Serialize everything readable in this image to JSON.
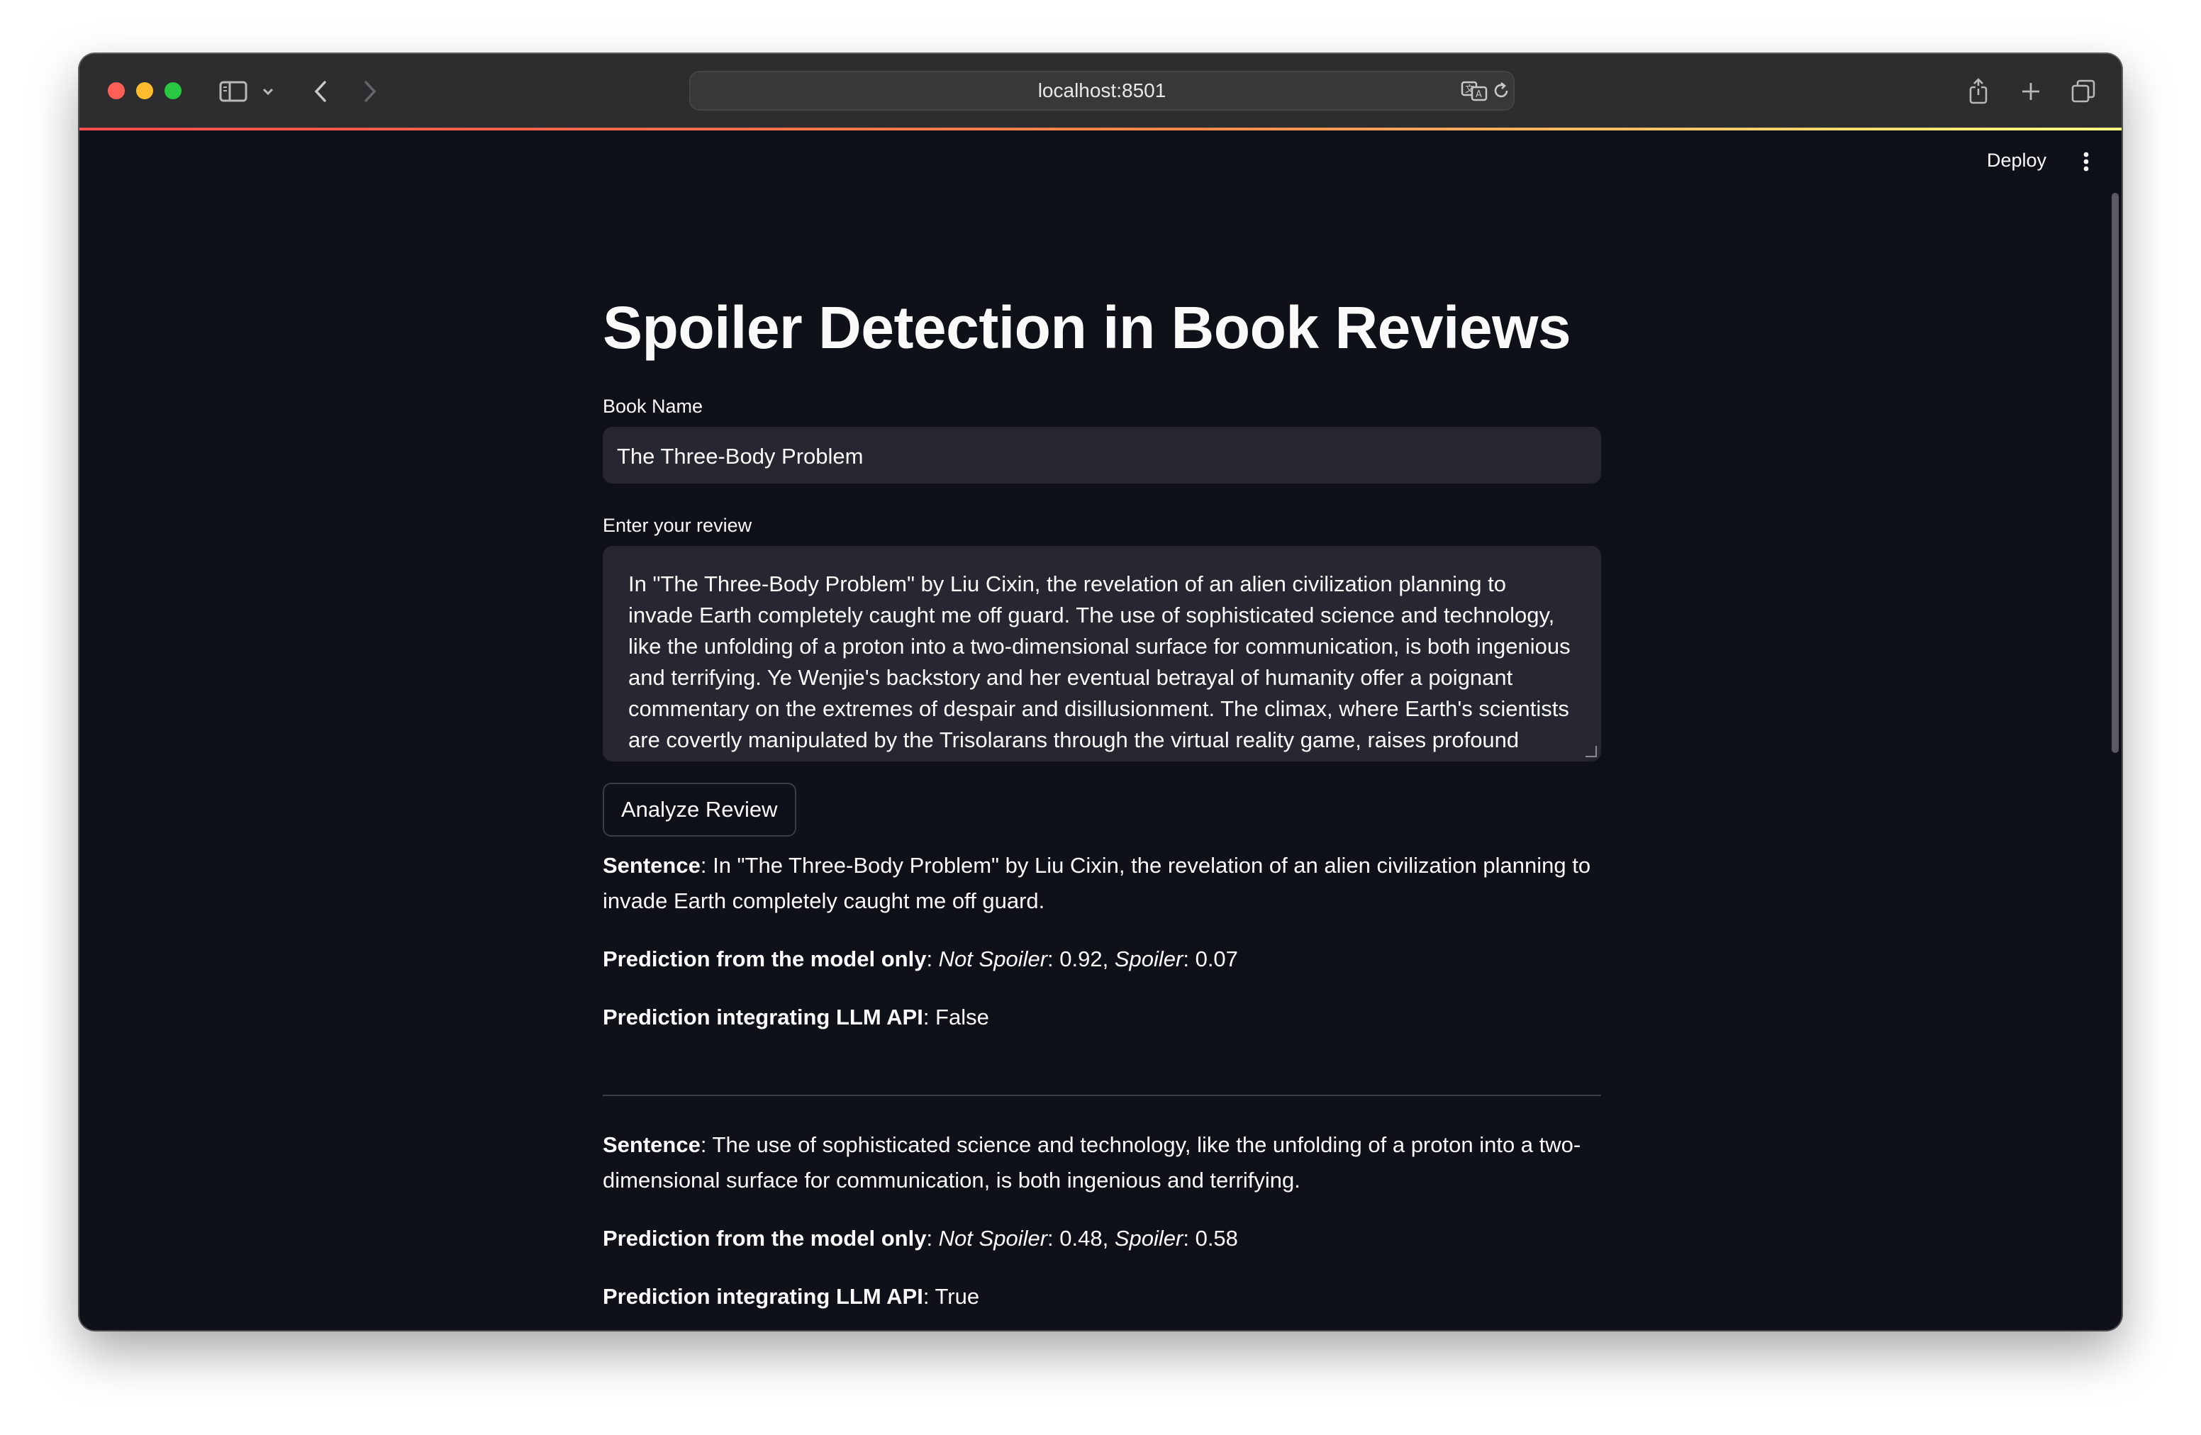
{
  "browser": {
    "url": "localhost:8501"
  },
  "app": {
    "deploy_label": "Deploy",
    "title": "Spoiler Detection in Book Reviews",
    "book_name_label": "Book Name",
    "book_name_value": "The Three-Body Problem",
    "review_label": "Enter your review",
    "review_value": "In \"The Three-Body Problem\" by Liu Cixin, the revelation of an alien civilization planning to invade Earth completely caught me off guard. The use of sophisticated science and technology, like the unfolding of a proton into a two-dimensional surface for communication, is both ingenious and terrifying. Ye Wenjie's backstory and her eventual betrayal of humanity offer a poignant commentary on the extremes of despair and disillusionment. The climax, where Earth's scientists are covertly manipulated by the Trisolarans through the virtual reality game, raises profound",
    "analyze_button": "Analyze Review"
  },
  "results": [
    {
      "sentence_label": "Sentence",
      "sentence": "In \"The Three-Body Problem\" by Liu Cixin, the revelation of an alien civilization planning to invade Earth completely caught me off guard.",
      "model_label": "Prediction from the model only",
      "not_spoiler_label": "Not Spoiler",
      "not_spoiler_value": "0.92",
      "spoiler_label": "Spoiler",
      "spoiler_value": "0.07",
      "llm_label": "Prediction integrating LLM API",
      "llm_value": "False"
    },
    {
      "sentence_label": "Sentence",
      "sentence": "The use of sophisticated science and technology, like the unfolding of a proton into a two-dimensional surface for communication, is both ingenious and terrifying.",
      "model_label": "Prediction from the model only",
      "not_spoiler_label": "Not Spoiler",
      "not_spoiler_value": "0.48",
      "spoiler_label": "Spoiler",
      "spoiler_value": "0.58",
      "llm_label": "Prediction integrating LLM API",
      "llm_value": "True"
    }
  ]
}
